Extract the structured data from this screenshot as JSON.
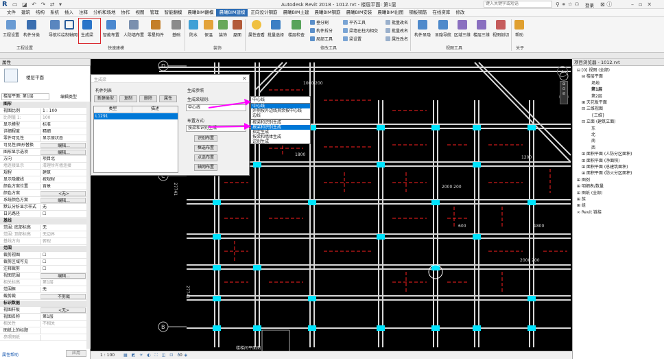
{
  "app": {
    "window_title": "Autodesk Revit 2018 -    1012.rvt - 楼层平面: 第1层",
    "search_placeholder": "键入关键字或短语",
    "user": "登录"
  },
  "menu": {
    "items": [
      "文件",
      "建筑",
      "结构",
      "系统",
      "插入",
      "注释",
      "分析和场地",
      "协作",
      "视图",
      "管理",
      "智能翻模",
      "晨曦BIM翻模",
      "晨曦BIM建模",
      "正向设计钢筋",
      "晨曦BIM土建",
      "晨曦BIM钢筋",
      "晨曦BIM安装",
      "晨曦BIM出图",
      "钢板钢筋",
      "在线资库",
      "修改"
    ],
    "active_index": 12
  },
  "ribbon": {
    "buttons": [
      "工程设置",
      "构件分类",
      "导航栏",
      "绘制轴网",
      "生成梁",
      "智能布置",
      "人防墙布置",
      "零星构件",
      "基础",
      "防水",
      "保温",
      "装饰",
      "屋面",
      "属性查看",
      "批量选择",
      "楼层检查",
      "构件显隐",
      "显隐导航",
      "区域三维",
      "楼层三维",
      "视图剖切",
      "帮助"
    ],
    "small": [
      "垂分割",
      "构件拆分",
      "局部工具",
      "平齐工具",
      "梁墙在柱内相交",
      "梁设置",
      "批量改名",
      "批量改名",
      "属性改名"
    ],
    "groups": [
      "工程设置",
      "快速建模",
      "装饰",
      "修改工具",
      "视图工具",
      "关于"
    ]
  },
  "properties": {
    "title": "属性",
    "type_name": "楼层平面",
    "selector": "楼层平面: 第1层",
    "edit_type": "编辑类型",
    "rows": [
      {
        "k": "图形",
        "v": "",
        "sec": true
      },
      {
        "k": "视图比例",
        "v": "1 : 100"
      },
      {
        "k": "比例值 1:",
        "v": "100",
        "gray": true
      },
      {
        "k": "显示模型",
        "v": "标准"
      },
      {
        "k": "详细程度",
        "v": "精细"
      },
      {
        "k": "零件可见性",
        "v": "显示原状态"
      },
      {
        "k": "可见性/图形替换",
        "v": "编辑...",
        "btn": true
      },
      {
        "k": "图形显示选项",
        "v": "编辑...",
        "btn": true
      },
      {
        "k": "方向",
        "v": "项目北"
      },
      {
        "k": "墙连接显示",
        "v": "清理所有墙连接",
        "gray": true
      },
      {
        "k": "规程",
        "v": "建筑"
      },
      {
        "k": "显示隐藏线",
        "v": "按规程"
      },
      {
        "k": "颜色方案位置",
        "v": "背景"
      },
      {
        "k": "颜色方案",
        "v": "<无>",
        "btn": true
      },
      {
        "k": "系统颜色方案",
        "v": "编辑...",
        "btn": true
      },
      {
        "k": "默认分析显示样式",
        "v": "无"
      },
      {
        "k": "日光路径",
        "v": "☐"
      },
      {
        "k": "基线",
        "v": "",
        "sec": true
      },
      {
        "k": "范围: 底部标高",
        "v": "无"
      },
      {
        "k": "范围: 顶部标高",
        "v": "无边界",
        "gray": true
      },
      {
        "k": "基线方向",
        "v": "俯视",
        "gray": true
      },
      {
        "k": "范围",
        "v": "",
        "sec": true
      },
      {
        "k": "裁剪视图",
        "v": "☐"
      },
      {
        "k": "裁剪区域可见",
        "v": "☐"
      },
      {
        "k": "注释裁剪",
        "v": "☐"
      },
      {
        "k": "视图范围",
        "v": "编辑...",
        "btn": true
      },
      {
        "k": "相关标高",
        "v": "第1层",
        "gray": true
      },
      {
        "k": "范围框",
        "v": "无"
      },
      {
        "k": "截剪裁",
        "v": "不剪裁",
        "btn": true
      },
      {
        "k": "标识数据",
        "v": "",
        "sec": true
      },
      {
        "k": "视图样板",
        "v": "<无>",
        "btn": true
      },
      {
        "k": "视图名称",
        "v": "第1层"
      },
      {
        "k": "相关性",
        "v": "不相关",
        "gray": true
      },
      {
        "k": "图纸上的标题",
        "v": ""
      },
      {
        "k": "参照图纸",
        "v": "",
        "gray": true
      }
    ],
    "help": "属性帮助",
    "apply": "应用"
  },
  "project_browser": {
    "title": "项目浏览器 - 1012.rvt",
    "nodes": [
      {
        "t": "⊟ [0] 视图 (全部)",
        "l": 0
      },
      {
        "t": "⊟ 楼层平面",
        "l": 1
      },
      {
        "t": "场地",
        "l": 3
      },
      {
        "t": "第1层",
        "l": 3,
        "bold": true
      },
      {
        "t": "第2层",
        "l": 3
      },
      {
        "t": "⊞ 天花板平面",
        "l": 1
      },
      {
        "t": "⊟ 三维视图",
        "l": 1
      },
      {
        "t": "{三维}",
        "l": 3
      },
      {
        "t": "⊟ 立面 (建筑立面)",
        "l": 1
      },
      {
        "t": "东",
        "l": 3
      },
      {
        "t": "北",
        "l": 3
      },
      {
        "t": "南",
        "l": 3
      },
      {
        "t": "西",
        "l": 3
      },
      {
        "t": "⊞ 面积平面 (人防分区面积)",
        "l": 1
      },
      {
        "t": "⊞ 面积平面 (净面积)",
        "l": 1
      },
      {
        "t": "⊞ 面积平面 (总建筑面积)",
        "l": 1
      },
      {
        "t": "⊞ 面积平面 (防火分区面积)",
        "l": 1
      },
      {
        "t": "⊞ 图例",
        "l": 0
      },
      {
        "t": "⊞ 明细表/数量",
        "l": 0
      },
      {
        "t": "⊞ 图纸 (全部)",
        "l": 0
      },
      {
        "t": "⊞ 族",
        "l": 0
      },
      {
        "t": "⊞ 组",
        "l": 0
      },
      {
        "t": "∞ Revit 链接",
        "l": 0
      }
    ]
  },
  "dialog": {
    "title": "生成梁",
    "list_label": "构件列表",
    "btn_new": "新建类型",
    "btn_copy": "复制",
    "btn_delete": "删除",
    "btn_props": "属性",
    "col_type": "类型",
    "col_desc": "描述",
    "row_type": "L1291",
    "gen_label": "生成参照",
    "rule_label": "生成梁规则:",
    "rule_value": "中心线",
    "rule_options": [
      "中心线",
      "外侧按外边线其余按中心线",
      "边线"
    ],
    "mode_label": "布置方式:",
    "mode_value": "按梁和识别生成",
    "mode_options": [
      "按梁和识别生成",
      "按梁和识别生成",
      "指定生成",
      "按梁和墙体生成",
      "识别生成"
    ],
    "btn_identify": "识别布置",
    "btn_frame": "框选布置",
    "btn_point": "点选布置",
    "btn_axis": "轴网布置"
  },
  "drawing": {
    "axis_labels": [
      "D",
      "C",
      "B"
    ],
    "dims": [
      "1800",
      "2000 200",
      "1000 200",
      "2000 200",
      "1200",
      "600",
      "1800",
      "27741",
      "27741"
    ],
    "bottom_label": "楼梯间平面图"
  },
  "statusbar": {
    "scale": "1 : 100",
    "value": ":0"
  },
  "colors": {
    "accent": "#2d6db5",
    "highlight": "#d9242a",
    "arrow": "#ff00ff",
    "cyan": "#00e5ff"
  }
}
